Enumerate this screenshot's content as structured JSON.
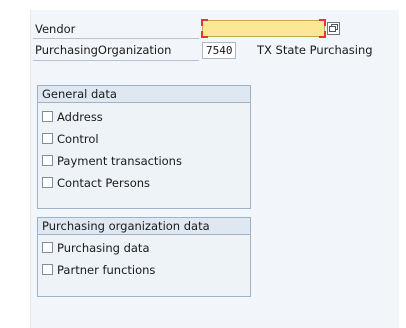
{
  "fields": {
    "vendor_label": "Vendor",
    "vendor_value": "",
    "purch_org_label": "PurchasingOrganization",
    "purch_org_value": "7540",
    "purch_org_text": "TX State Purchasing"
  },
  "general_data": {
    "title": "General data",
    "options": [
      {
        "label": "Address",
        "checked": false
      },
      {
        "label": "Control",
        "checked": false
      },
      {
        "label": "Payment transactions",
        "checked": false
      },
      {
        "label": "Contact Persons",
        "checked": false
      }
    ]
  },
  "purchasing_org_data": {
    "title": "Purchasing organization data",
    "options": [
      {
        "label": "Purchasing data",
        "checked": false
      },
      {
        "label": "Partner functions",
        "checked": false
      }
    ]
  },
  "colors": {
    "required_field": "#fbe795",
    "required_marker": "#e03a2e",
    "group_border": "#9fb3c8",
    "background": "#f2f5f9"
  }
}
